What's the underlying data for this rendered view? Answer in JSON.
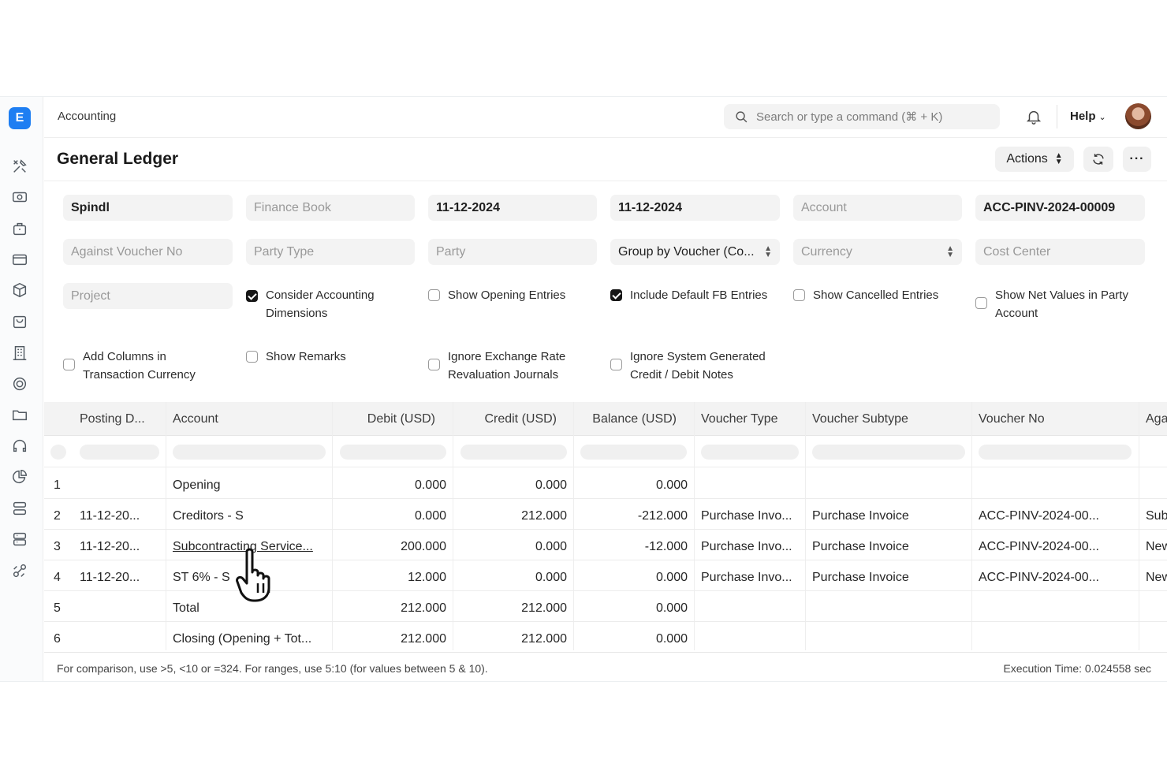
{
  "app": {
    "logo_letter": "E"
  },
  "sidebar": {
    "icons": [
      "tools-icon",
      "money-icon",
      "briefcase-icon",
      "card-icon",
      "box-icon",
      "bag-icon",
      "building-icon",
      "target-icon",
      "folder-icon",
      "headset-icon",
      "pie-icon",
      "server-icon",
      "database-icon",
      "integration-icon"
    ]
  },
  "topbar": {
    "breadcrumb": "Accounting",
    "search_placeholder": "Search or type a command (⌘ + K)",
    "help_label": "Help"
  },
  "page": {
    "title": "General Ledger",
    "actions_label": "Actions",
    "more_label": "···"
  },
  "filters": {
    "company": "Spindl",
    "finance_book": "Finance Book",
    "from_date": "11-12-2024",
    "to_date": "11-12-2024",
    "account": "Account",
    "voucher_no": "ACC-PINV-2024-00009",
    "against_voucher_no": "Against Voucher No",
    "party_type": "Party Type",
    "party": "Party",
    "group_by": "Group by Voucher (Co...",
    "currency": "Currency",
    "cost_center": "Cost Center",
    "project": "Project"
  },
  "checkboxes": {
    "consider_dimensions": {
      "label1": "Consider Accounting",
      "label2": "Dimensions",
      "checked": true
    },
    "show_opening": {
      "label1": "Show Opening Entries",
      "checked": false
    },
    "include_default_fb": {
      "label1": "Include Default FB Entries",
      "checked": true
    },
    "show_cancelled": {
      "label1": "Show Cancelled Entries",
      "checked": false
    },
    "show_net_values": {
      "label1": "Show Net Values in Party",
      "label2": "Account",
      "checked": false
    },
    "add_columns": {
      "label1": "Add Columns in",
      "label2": "Transaction Currency",
      "checked": false
    },
    "show_remarks": {
      "label1": "Show Remarks",
      "checked": false
    },
    "ignore_exchange": {
      "label1": "Ignore Exchange Rate",
      "label2": "Revaluation Journals",
      "checked": false
    },
    "ignore_system": {
      "label1": "Ignore System Generated",
      "label2": "Credit / Debit Notes",
      "checked": false
    }
  },
  "table": {
    "columns": [
      "Posting D...",
      "Account",
      "Debit (USD)",
      "Credit (USD)",
      "Balance (USD)",
      "Voucher Type",
      "Voucher Subtype",
      "Voucher No",
      "Aga"
    ],
    "rows": [
      {
        "n": "1",
        "date": "",
        "account": "Opening",
        "debit": "0.000",
        "credit": "0.000",
        "balance": "0.000",
        "vtype": "",
        "vsub": "",
        "vno": "",
        "against": ""
      },
      {
        "n": "2",
        "date": "11-12-20...",
        "account": "Creditors - S",
        "debit": "0.000",
        "credit": "212.000",
        "balance": "-212.000",
        "vtype": "Purchase Invo...",
        "vsub": "Purchase Invoice",
        "vno": "ACC-PINV-2024-00...",
        "against": "Sub"
      },
      {
        "n": "3",
        "date": "11-12-20...",
        "account": "Subcontracting Service...",
        "debit": "200.000",
        "credit": "0.000",
        "balance": "-12.000",
        "vtype": "Purchase Invo...",
        "vsub": "Purchase Invoice",
        "vno": "ACC-PINV-2024-00...",
        "against": "New"
      },
      {
        "n": "4",
        "date": "11-12-20...",
        "account": "ST 6% - S",
        "debit": "12.000",
        "credit": "0.000",
        "balance": "0.000",
        "vtype": "Purchase Invo...",
        "vsub": "Purchase Invoice",
        "vno": "ACC-PINV-2024-00...",
        "against": "New"
      },
      {
        "n": "5",
        "date": "",
        "account": "Total",
        "debit": "212.000",
        "credit": "212.000",
        "balance": "0.000",
        "vtype": "",
        "vsub": "",
        "vno": "",
        "against": ""
      },
      {
        "n": "6",
        "date": "",
        "account": "Closing (Opening + Tot...",
        "debit": "212.000",
        "credit": "212.000",
        "balance": "0.000",
        "vtype": "",
        "vsub": "",
        "vno": "",
        "against": ""
      }
    ]
  },
  "footer": {
    "hint": "For comparison, use >5, <10 or =324. For ranges, use 5:10 (for values between 5 & 10).",
    "execution_time": "Execution Time: 0.024558 sec"
  }
}
